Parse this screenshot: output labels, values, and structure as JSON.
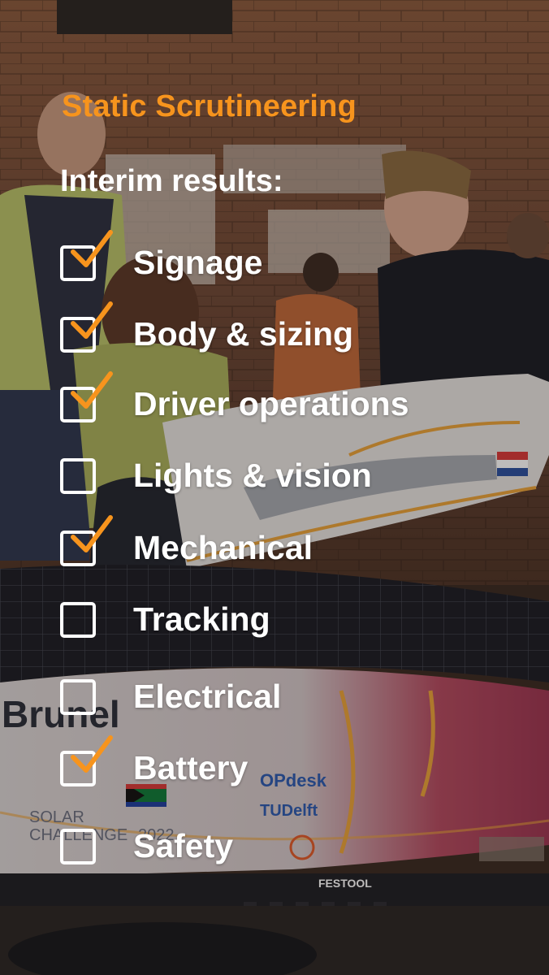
{
  "header": {
    "title": "Static Scrutineering",
    "subtitle": "Interim results:"
  },
  "accent_color": "#f7941d",
  "text_color": "#ffffff",
  "checklist": [
    {
      "label": "Signage",
      "checked": true
    },
    {
      "label": "Body & sizing",
      "checked": true
    },
    {
      "label": "Driver operations",
      "checked": true
    },
    {
      "label": "Lights & vision",
      "checked": false
    },
    {
      "label": "Mechanical",
      "checked": true
    },
    {
      "label": "Tracking",
      "checked": false
    },
    {
      "label": "Electrical",
      "checked": false
    },
    {
      "label": "Battery",
      "checked": true
    },
    {
      "label": "Safety",
      "checked": false
    }
  ],
  "background": {
    "car_text": [
      "Brunel",
      "SOLAR",
      "CHALLENGE",
      "2022",
      "TUDelft",
      "OPdesk",
      "FESTOOL"
    ]
  }
}
